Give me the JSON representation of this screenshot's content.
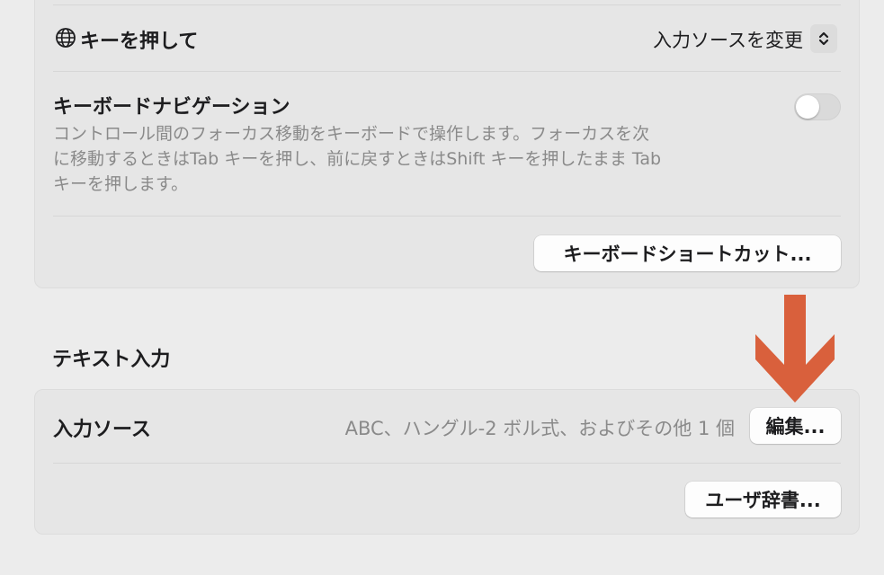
{
  "keyboard_section": {
    "globe_key": {
      "icon": "globe-icon",
      "label": "キーを押して",
      "value": "入力ソースを変更"
    },
    "keyboard_navigation": {
      "label": "キーボードナビゲーション",
      "description_lines": [
        "コントロール間のフォーカス移動をキーボードで操作します。フォーカスを次",
        "に移動するときはTab キーを押し、前に戻すときはShift キーを押したまま Tab",
        "キーを押します。"
      ],
      "enabled": false
    },
    "shortcuts_button_label": "キーボードショートカット..."
  },
  "text_input_section": {
    "header": "テキスト入力",
    "input_sources": {
      "label": "入力ソース",
      "value": "ABC、ハングル-2 ボル式、およびその他 1 個",
      "edit_button_label": "編集..."
    },
    "user_dictionary_button_label": "ユーザ辞書..."
  },
  "annotation": {
    "arrow_color": "#d9603c",
    "arrow_icon": "arrow-down-icon"
  }
}
